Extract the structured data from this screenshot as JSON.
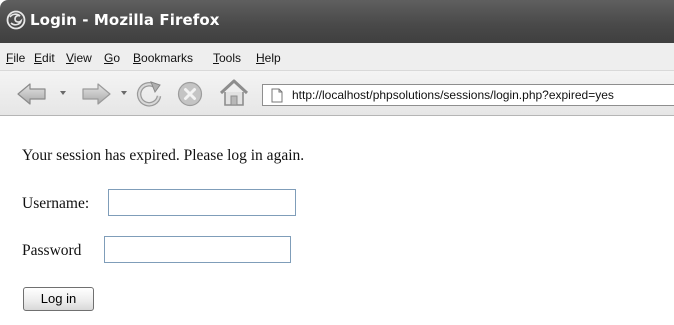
{
  "window": {
    "title": "Login - Mozilla Firefox"
  },
  "menubar": {
    "items": [
      {
        "label": "File",
        "underline": "F",
        "rest": "ile"
      },
      {
        "label": "Edit",
        "underline": "E",
        "rest": "dit"
      },
      {
        "label": "View",
        "underline": "V",
        "rest": "iew"
      },
      {
        "label": "Go",
        "underline": "G",
        "rest": "o"
      },
      {
        "label": "Bookmarks",
        "underline": "B",
        "rest": "ookmarks"
      },
      {
        "label": "Tools",
        "underline": "T",
        "rest": "ools"
      },
      {
        "label": "Help",
        "underline": "H",
        "rest": "elp"
      }
    ]
  },
  "navbar": {
    "back_icon": "back-arrow-icon",
    "forward_icon": "forward-arrow-icon",
    "reload_icon": "reload-icon",
    "stop_icon": "stop-icon",
    "home_icon": "home-icon",
    "url": "http://localhost/phpsolutions/sessions/login.php?expired=yes"
  },
  "page": {
    "message": "Your session has expired. Please log in again.",
    "username_label": "Username:",
    "username_value": "",
    "password_label": "Password",
    "password_value": "",
    "login_button": "Log in"
  }
}
